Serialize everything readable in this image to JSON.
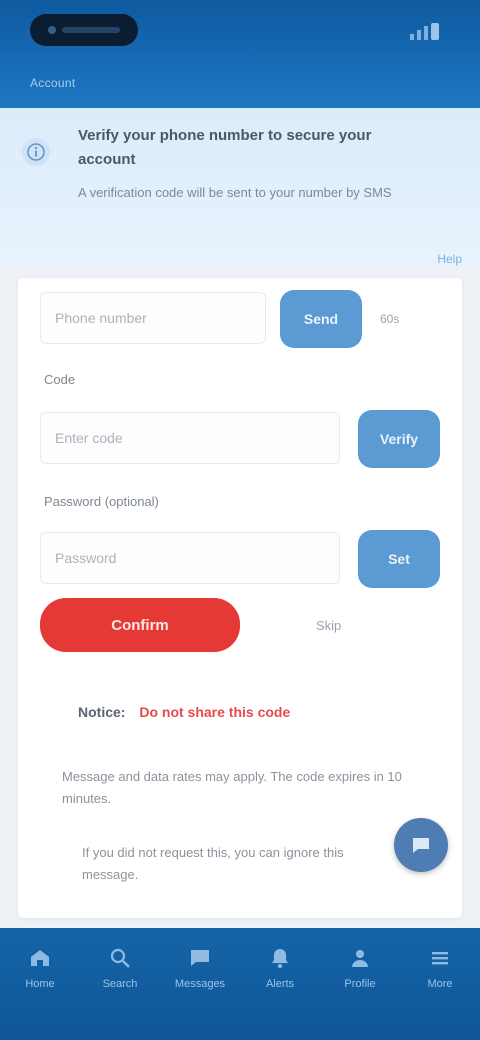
{
  "topbar": {
    "title": "Account"
  },
  "banner": {
    "title": "Verify your phone number to secure your account",
    "subtitle": "A verification code will be sent to your number by SMS",
    "link": "Help"
  },
  "form": {
    "phone_placeholder": "Phone number",
    "send_button": "Send",
    "send_side": "60s",
    "code_label": "Code",
    "code_placeholder": "Enter code",
    "code_button": "Verify",
    "password_label": "Password (optional)",
    "password_placeholder": "Password",
    "password_button": "Set",
    "confirm_button": "Confirm",
    "skip_link": "Skip"
  },
  "notice": {
    "label": "Notice:",
    "highlight": "Do not share this code"
  },
  "paragraphs": [
    "Message and data rates may apply. The code expires in 10 minutes.",
    "If you did not request this, you can ignore this message."
  ],
  "nav": {
    "items": [
      {
        "label": "Home",
        "icon": "home-icon"
      },
      {
        "label": "Search",
        "icon": "search-icon"
      },
      {
        "label": "Messages",
        "icon": "chat-icon"
      },
      {
        "label": "Alerts",
        "icon": "bell-icon"
      },
      {
        "label": "Profile",
        "icon": "user-icon"
      },
      {
        "label": "More",
        "icon": "menu-icon"
      }
    ]
  },
  "colors": {
    "primary": "#176cb5",
    "accent_blue": "#5b9ad2",
    "danger": "#e53935",
    "banner_bg": "#dcecfb"
  }
}
